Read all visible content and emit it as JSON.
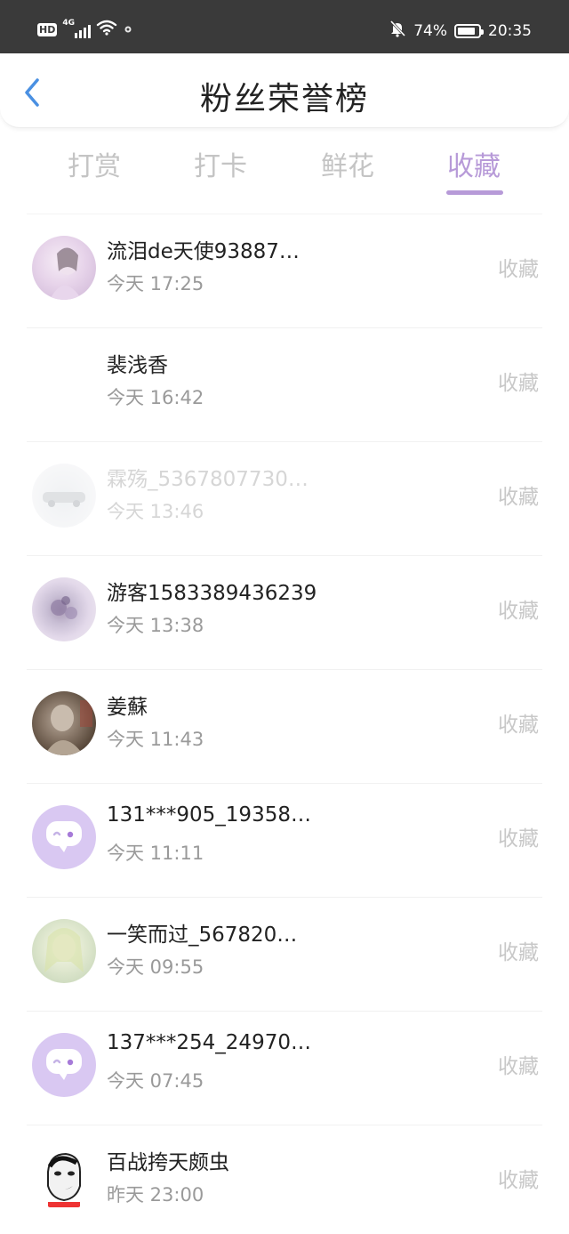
{
  "status_bar": {
    "hd": "HD",
    "network": "4G",
    "battery_percent": "74%",
    "battery_level": 0.74,
    "time": "20:35",
    "icons": [
      "hd-icon",
      "signal-icon",
      "wifi-icon",
      "notification-dot-icon",
      "mute-bell-icon",
      "battery-icon"
    ]
  },
  "header": {
    "back_icon": "chevron-left-icon",
    "title": "粉丝荣誉榜"
  },
  "tabs": [
    {
      "label": "打赏",
      "active": false
    },
    {
      "label": "打卡",
      "active": false
    },
    {
      "label": "鲜花",
      "active": false
    },
    {
      "label": "收藏",
      "active": true
    }
  ],
  "colors": {
    "accent": "#b79ad8",
    "tab_inactive": "#c4c4c4",
    "status_bar_bg": "#3a3a3a",
    "back_arrow": "#4a90e2"
  },
  "list": [
    {
      "name": "流泪de天使93887…",
      "time": "今天 17:25",
      "action": "收藏",
      "avatar": "avatar-image"
    },
    {
      "name": "裴浅香",
      "time": "今天 16:42",
      "action": "收藏",
      "avatar": "avatar-blank"
    },
    {
      "name": "霖殇_5367807730…",
      "time": "今天 13:46",
      "action": "收藏",
      "avatar": "avatar-image"
    },
    {
      "name": "游客1583389436239",
      "time": "今天 13:38",
      "action": "收藏",
      "avatar": "avatar-image"
    },
    {
      "name": "姜蘇",
      "time": "今天 11:43",
      "action": "收藏",
      "avatar": "avatar-image"
    },
    {
      "name": "131***905_19358…",
      "time": "今天 11:11",
      "action": "收藏",
      "avatar": "default-chat-avatar-icon"
    },
    {
      "name": "一笑而过_567820…",
      "time": "今天 09:55",
      "action": "收藏",
      "avatar": "avatar-image"
    },
    {
      "name": "137***254_24970…",
      "time": "今天 07:45",
      "action": "收藏",
      "avatar": "default-chat-avatar-icon"
    },
    {
      "name": "百战挎天颇虫",
      "time": "昨天 23:00",
      "action": "收藏",
      "avatar": "avatar-image"
    }
  ]
}
